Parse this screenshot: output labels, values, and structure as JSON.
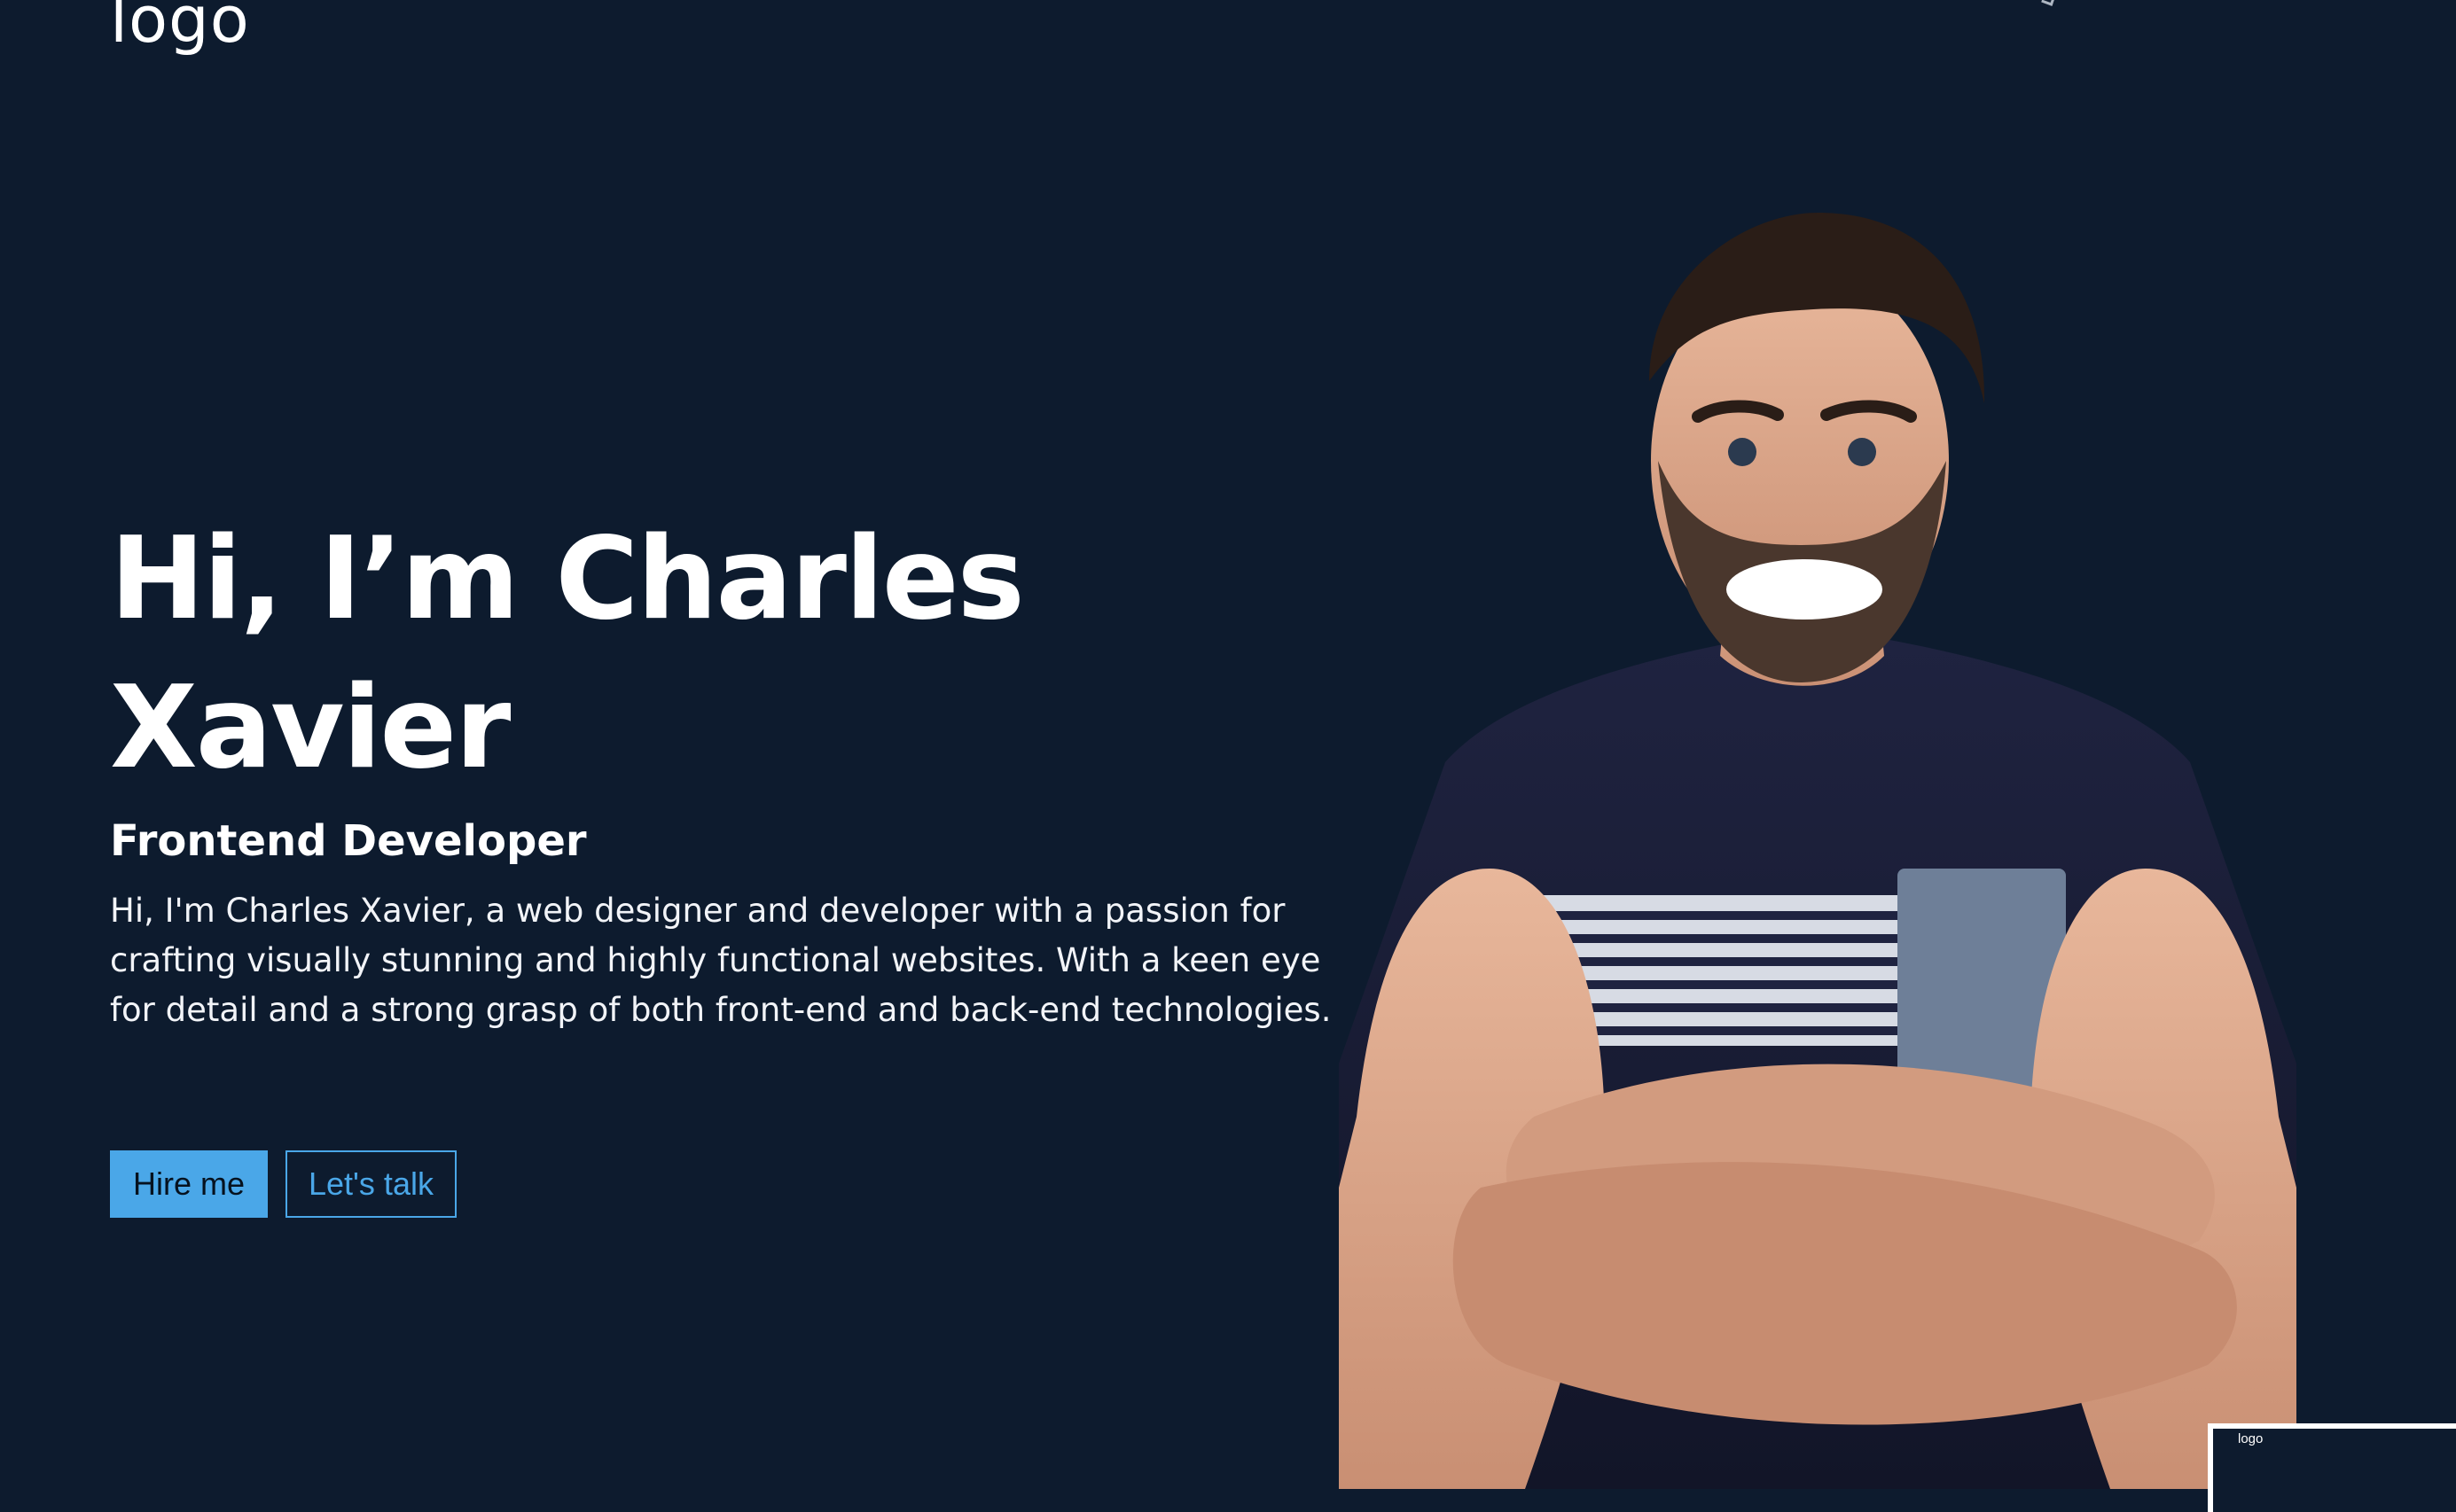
{
  "header": {
    "logo_text": "logo"
  },
  "hero": {
    "title": "Hi, I’m Charles Xavier",
    "subtitle": "Frontend Developer",
    "description": "Hi, I'm Charles Xavier, a web designer and developer with a passion for crafting visually stunning and highly functional websites. With a keen eye for detail and a strong grasp of both front-end and back-end technologies.",
    "buttons": {
      "hire_label": "Hire me",
      "talk_label": "Let's talk"
    }
  },
  "mini_preview": {
    "logo_text": "logo"
  },
  "colors": {
    "background": "#0d1b2e",
    "accent": "#4aa7e8",
    "text": "#ffffff"
  },
  "icons": {
    "portrait": "portrait-image",
    "nav": "chevron-icon"
  }
}
